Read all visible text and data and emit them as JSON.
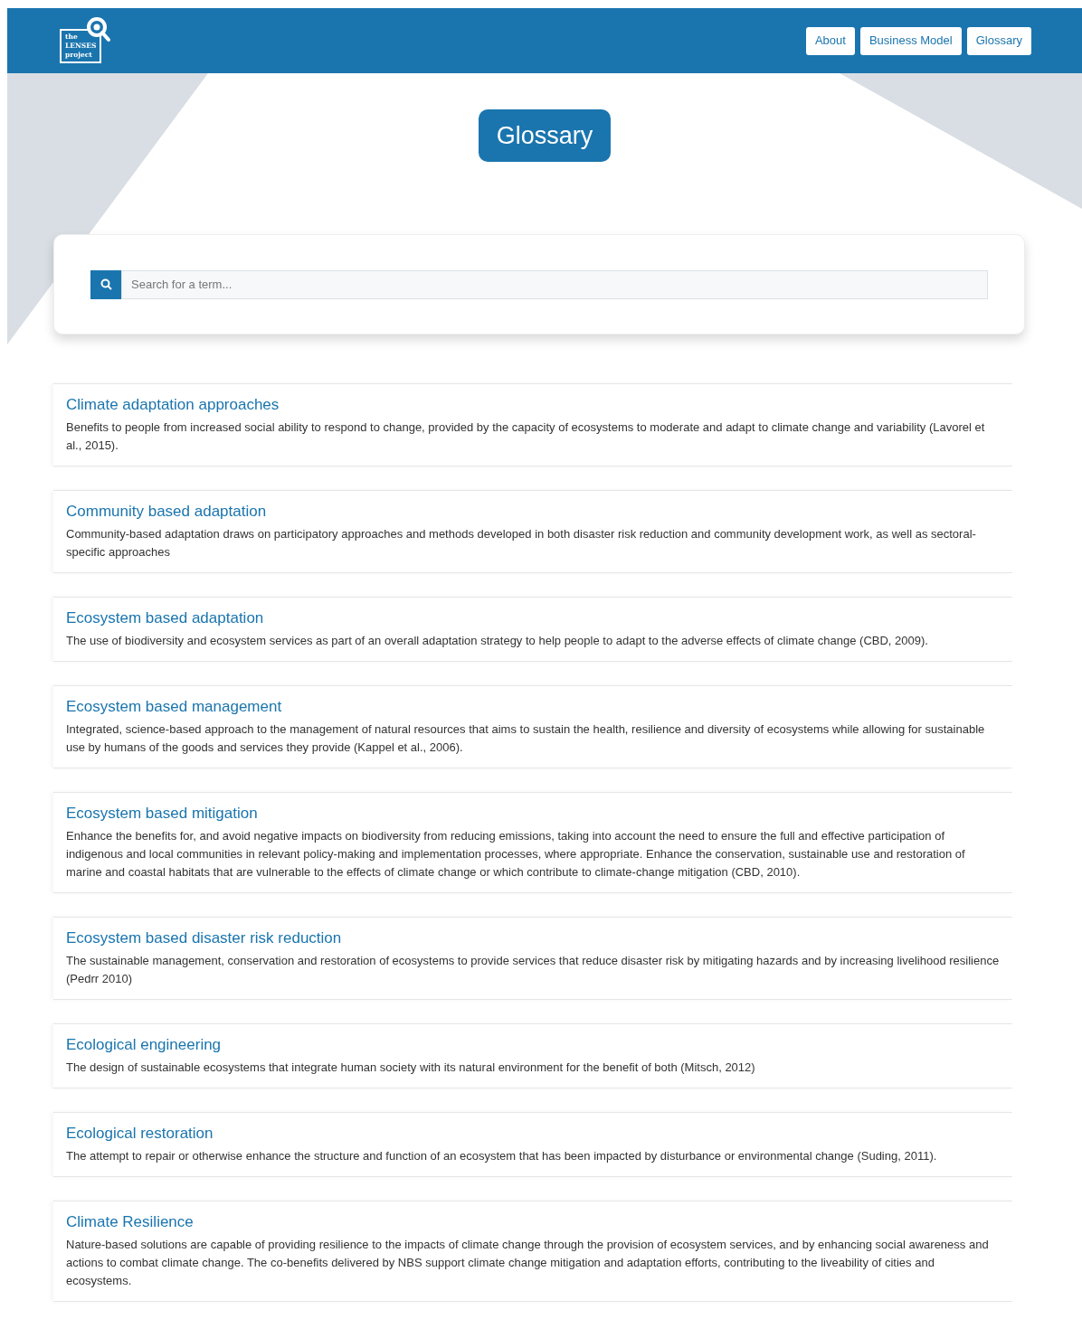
{
  "logo": {
    "lines": [
      "the",
      "LENSES",
      "project"
    ]
  },
  "nav": [
    {
      "label": "About"
    },
    {
      "label": "Business Model"
    },
    {
      "label": "Glossary"
    }
  ],
  "page_title": "Glossary",
  "search": {
    "placeholder": "Search for a term..."
  },
  "entries": [
    {
      "term": "Climate adaptation approaches",
      "definition": "Benefits to people from increased social ability to respond to change, provided by the capacity of ecosystems to moderate and adapt to climate change and variability (Lavorel et al., 2015)."
    },
    {
      "term": "Community based adaptation",
      "definition": "Community-based adaptation draws on participatory approaches and methods developed in both disaster risk reduction and community development work, as well as sectoral-specific approaches"
    },
    {
      "term": "Ecosystem based adaptation",
      "definition": "The use of biodiversity and ecosystem services as part of an overall adaptation strategy to help people to adapt to the adverse effects of climate change (CBD, 2009)."
    },
    {
      "term": "Ecosystem based management",
      "definition": "Integrated, science-based approach to the management of natural resources that aims to sustain the health, resilience and diversity of ecosystems while allowing for sustainable use by humans of the goods and services they provide (Kappel et al., 2006)."
    },
    {
      "term": "Ecosystem based mitigation",
      "definition": "Enhance the benefits for, and avoid negative impacts on biodiversity from reducing emissions, taking into account the need to ensure the full and effective participation of indigenous and local communities in relevant policy-making and implementation processes, where appropriate. Enhance the conservation, sustainable use and restoration of marine and coastal habitats that are vulnerable to the effects of climate change or which contribute to climate-change mitigation (CBD, 2010)."
    },
    {
      "term": "Ecosystem based disaster risk reduction",
      "definition": "The sustainable management, conservation and restoration of ecosystems to provide services that reduce disaster risk by mitigating hazards and by increasing livelihood resilience (Pedrr 2010)"
    },
    {
      "term": "Ecological engineering",
      "definition": "The design of sustainable ecosystems that integrate human society with its natural environment for the benefit of both (Mitsch, 2012)"
    },
    {
      "term": "Ecological restoration",
      "definition": "The attempt to repair or otherwise enhance the structure and function of an ecosystem that has been impacted by disturbance or environmental change (Suding, 2011)."
    },
    {
      "term": "Climate Resilience",
      "definition": "Nature-based solutions are capable of providing resilience to the impacts of climate change through the provision of ecosystem services, and by enhancing social awareness and actions to combat climate change. The co-benefits delivered by NBS support climate change mitigation and adaptation efforts, contributing to the liveability of cities and ecosystems."
    }
  ]
}
